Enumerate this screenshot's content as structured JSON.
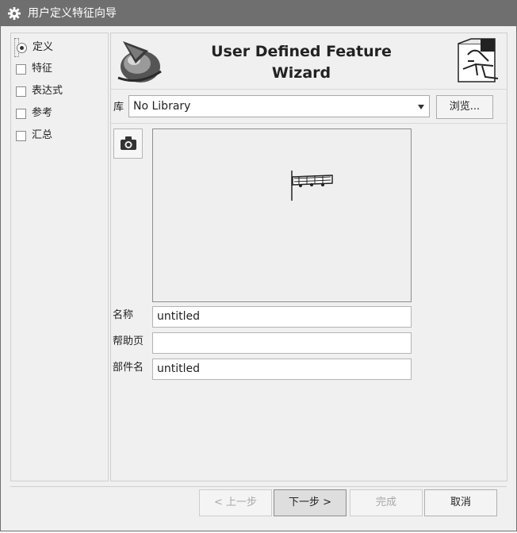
{
  "window": {
    "title": "用户定义特征向导",
    "icon": "gear-icon"
  },
  "steps": [
    {
      "label": "定义",
      "state": "current"
    },
    {
      "label": "特征",
      "state": "unchecked"
    },
    {
      "label": "表达式",
      "state": "unchecked"
    },
    {
      "label": "参考",
      "state": "unchecked"
    },
    {
      "label": "汇总",
      "state": "unchecked"
    }
  ],
  "header": {
    "title_line1": "User Defined Feature",
    "title_line2": "Wizard"
  },
  "library": {
    "label": "库",
    "value": "No Library",
    "browse_label": "浏览..."
  },
  "fields": {
    "name": {
      "label": "名称",
      "value": "untitled"
    },
    "help_page": {
      "label": "帮助页",
      "value": ""
    },
    "part_name": {
      "label": "部件名",
      "value": "untitled"
    }
  },
  "buttons": {
    "back": "< 上一步",
    "next": "下一步 >",
    "finish": "完成",
    "cancel": "取消"
  }
}
